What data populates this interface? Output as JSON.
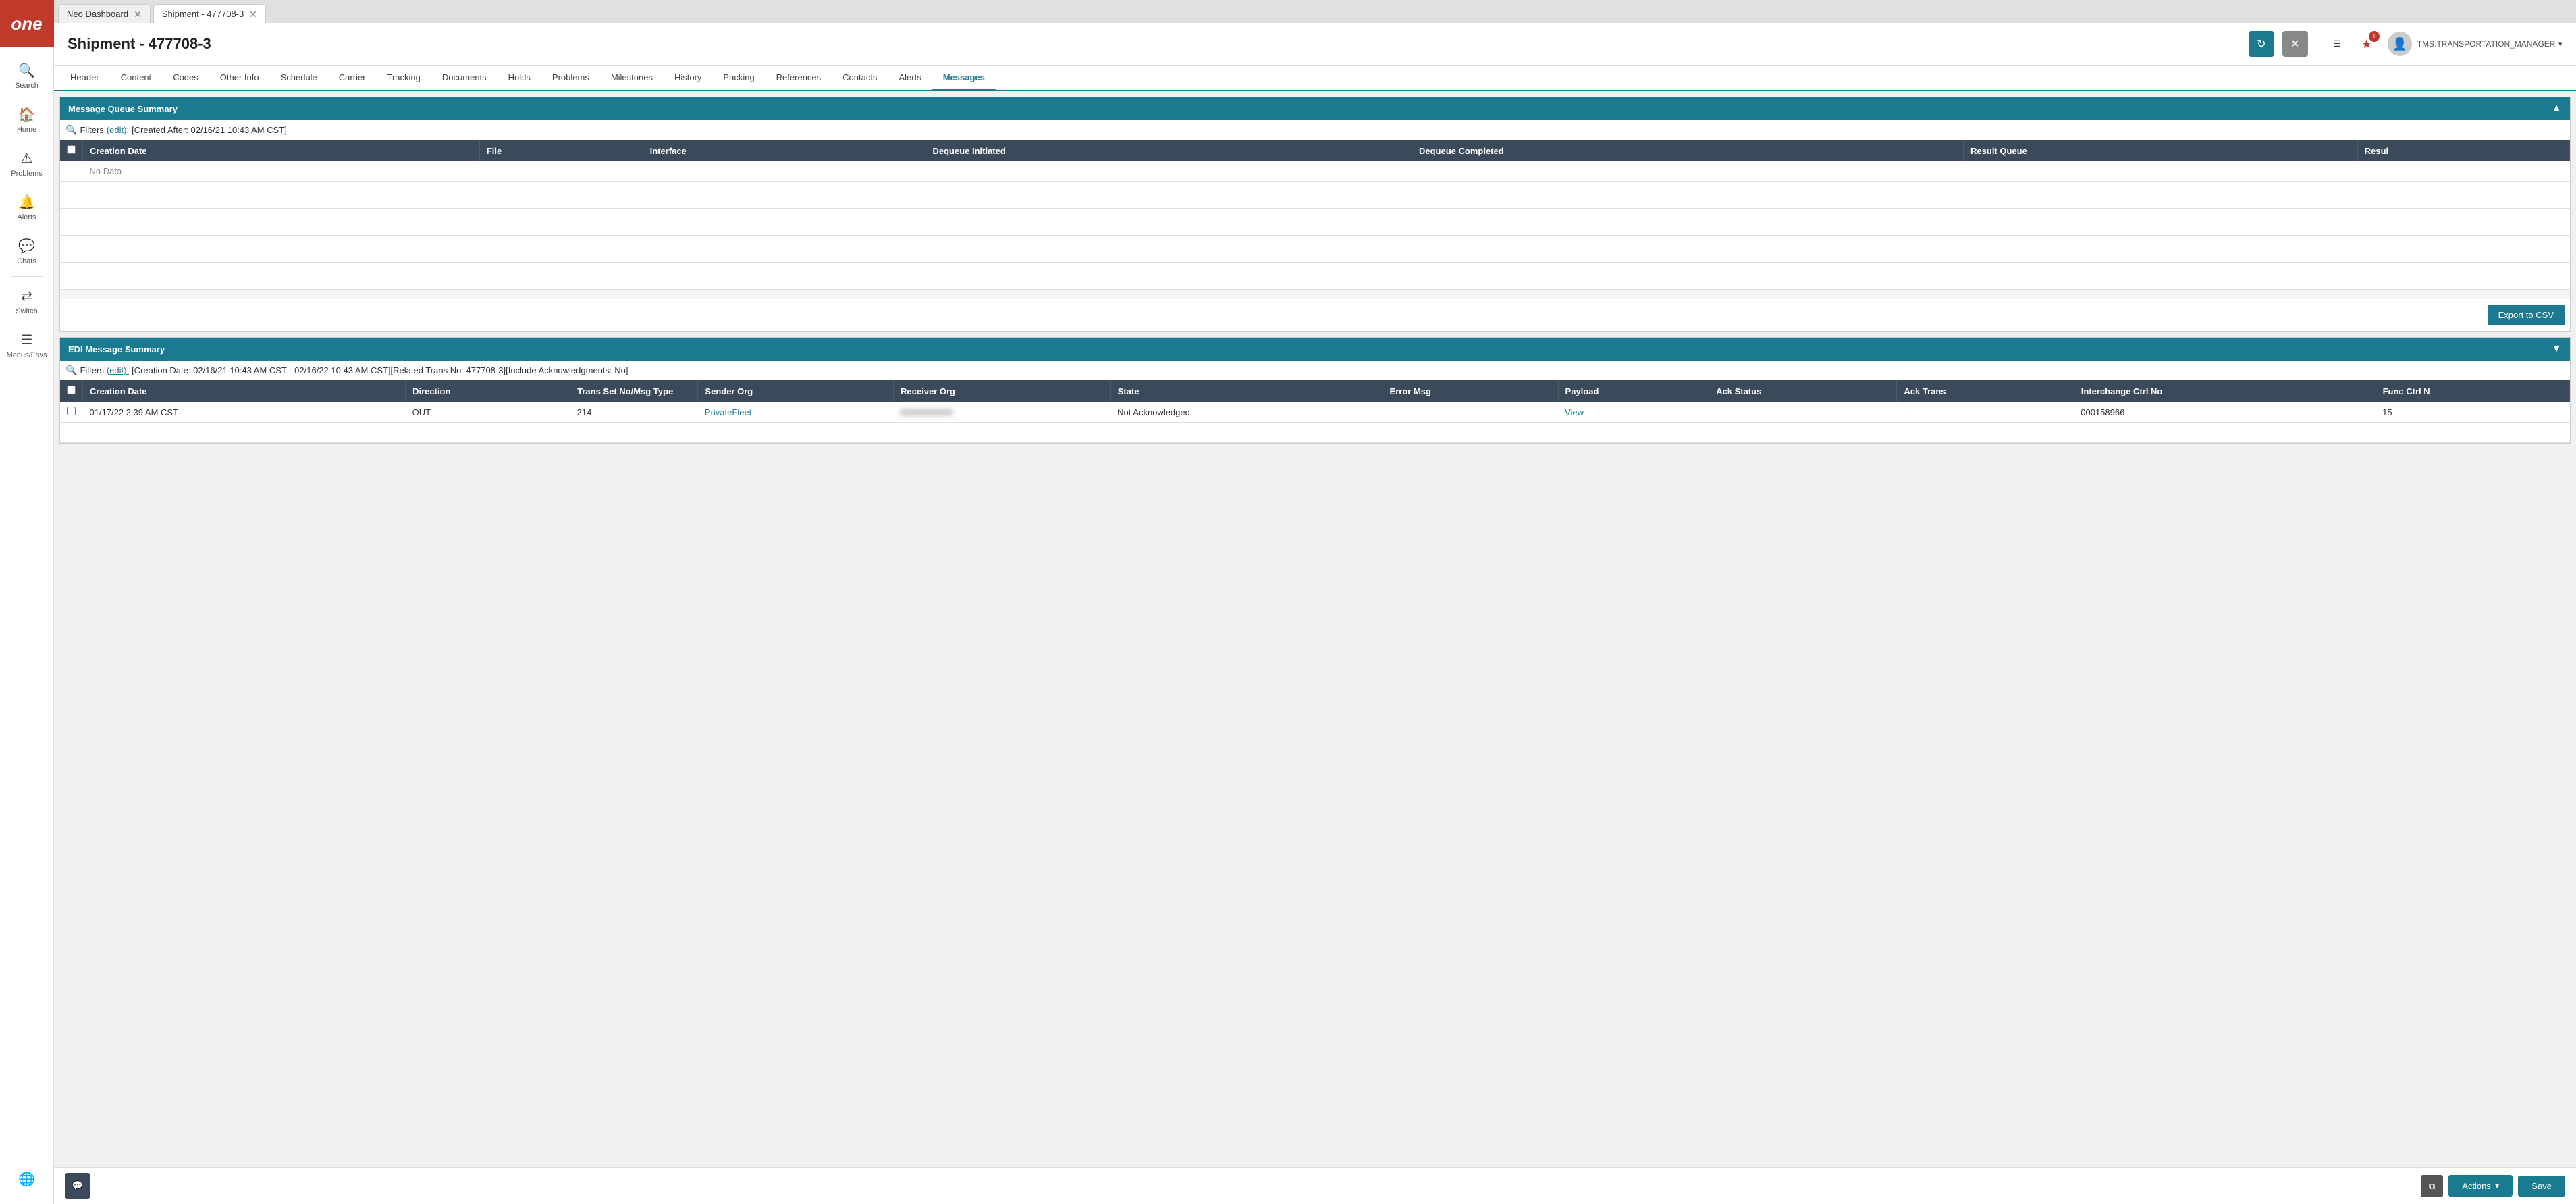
{
  "app": {
    "logo": "one",
    "tabs": [
      {
        "id": "neo-dashboard",
        "label": "Neo Dashboard",
        "active": false
      },
      {
        "id": "shipment-477708-3",
        "label": "Shipment - 477708-3",
        "active": true
      }
    ]
  },
  "sidebar": {
    "items": [
      {
        "id": "search",
        "icon": "🔍",
        "label": "Search"
      },
      {
        "id": "home",
        "icon": "🏠",
        "label": "Home"
      },
      {
        "id": "problems",
        "icon": "⚠",
        "label": "Problems"
      },
      {
        "id": "alerts",
        "icon": "🔔",
        "label": "Alerts"
      },
      {
        "id": "chats",
        "icon": "💬",
        "label": "Chats"
      },
      {
        "id": "switch",
        "icon": "⇄",
        "label": "Switch"
      },
      {
        "id": "menus-favs",
        "icon": "☰",
        "label": "Menus/Favs"
      }
    ],
    "globe_icon": "🌐"
  },
  "header": {
    "title": "Shipment - 477708-3",
    "refresh_label": "↻",
    "close_label": "✕",
    "menu_label": "☰",
    "user_role": "TMS.TRANSPORTATION_MANAGER",
    "user_avatar": "👤"
  },
  "inner_tabs": [
    "Header",
    "Content",
    "Codes",
    "Other Info",
    "Schedule",
    "Carrier",
    "Tracking",
    "Documents",
    "Holds",
    "Problems",
    "Milestones",
    "History",
    "Packing",
    "References",
    "Contacts",
    "Alerts",
    "Messages"
  ],
  "active_tab": "Messages",
  "message_queue": {
    "section_title": "Message Queue Summary",
    "filters_label": "Filters",
    "edit_label": "(edit):",
    "filter_text": "[Created After: 02/16/21 10:43 AM CST]",
    "columns": [
      "Creation Date",
      "File",
      "Interface",
      "Dequeue Initiated",
      "Dequeue Completed",
      "Result Queue",
      "Result"
    ],
    "rows": [],
    "no_data": "No Data",
    "export_btn": "Export to CSV"
  },
  "edi_summary": {
    "section_title": "EDI Message Summary",
    "filters_label": "Filters",
    "edit_label": "(edit):",
    "filter_text": "[Creation Date: 02/16/21 10:43 AM CST - 02/16/22 10:43 AM CST][Related Trans No: 477708-3][Include Acknowledgments: No]",
    "columns": [
      "Creation Date",
      "Direction",
      "Trans Set No/Msg Type",
      "Sender Org",
      "Receiver Org",
      "State",
      "Error Msg",
      "Payload",
      "Ack Status",
      "Ack Trans",
      "Interchange Ctrl No",
      "Func Ctrl N"
    ],
    "rows": [
      {
        "creation_date": "01/17/22 2:39 AM CST",
        "direction": "OUT",
        "trans_set": "214",
        "sender_org": "PrivateFleet",
        "sender_org_link": true,
        "receiver_org": "blurred",
        "state": "Not Acknowledged",
        "error_msg": "",
        "payload_label": "View",
        "payload_link": true,
        "ack_status": "",
        "ack_trans": "--",
        "interchange_ctrl": "000158966",
        "func_ctrl": "15"
      }
    ]
  },
  "footer": {
    "chat_icon": "💬",
    "copy_icon": "⧉",
    "actions_label": "Actions",
    "actions_arrow": "▾",
    "save_label": "Save"
  }
}
